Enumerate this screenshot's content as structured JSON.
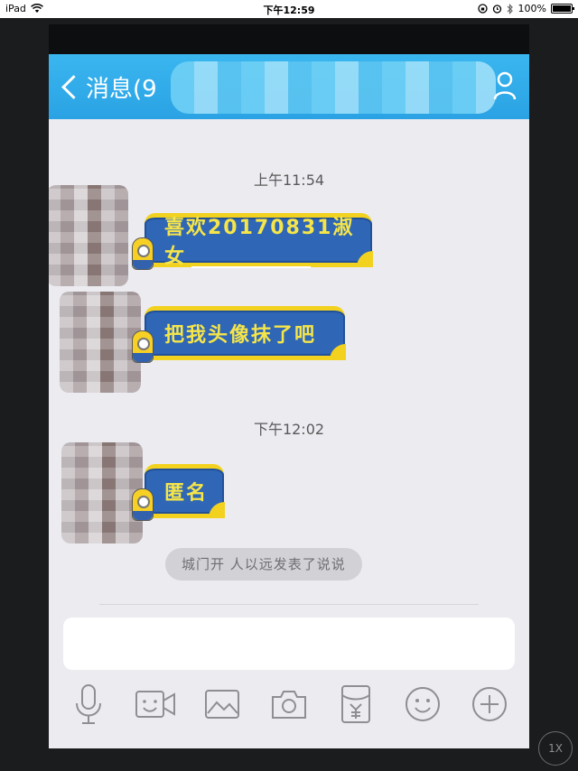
{
  "status_bar": {
    "device": "iPad",
    "time": "下午12:59",
    "battery": "100%"
  },
  "nav": {
    "back_label": "消息(9"
  },
  "messages": [
    {
      "type": "timestamp",
      "text": "上午11:54"
    },
    {
      "type": "bubble",
      "text": "喜欢20170831淑女"
    },
    {
      "type": "bubble",
      "text": "把我头像抹了吧"
    },
    {
      "type": "timestamp",
      "text": "下午12:02"
    },
    {
      "type": "bubble",
      "text": "匿名"
    }
  ],
  "system_notice": "城门开 人以远发表了说说",
  "zoom_label": "1X",
  "colors": {
    "nav_blue": "#2aa2e4",
    "bubble_blue": "#2f66b5",
    "bubble_yellow": "#f2d21f",
    "screen_bg": "#ebebf0"
  },
  "toolbar_icons": [
    "microphone-icon",
    "video-call-icon",
    "image-icon",
    "camera-icon",
    "red-envelope-icon",
    "emoji-icon",
    "plus-icon"
  ]
}
